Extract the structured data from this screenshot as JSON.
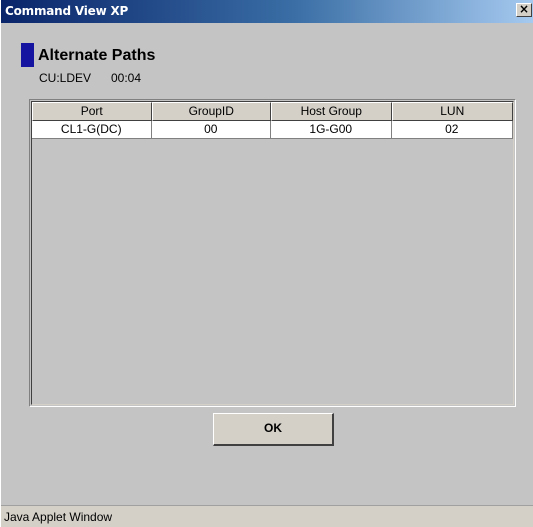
{
  "window": {
    "title": "Command View XP",
    "close_glyph": "×"
  },
  "section": {
    "title": "Alternate Paths",
    "marker_color": "#1414a0",
    "cu_label": "CU:LDEV",
    "cu_value": "00:04"
  },
  "table": {
    "columns": [
      "Port",
      "GroupID",
      "Host Group",
      "LUN"
    ],
    "rows": [
      [
        "CL1-G(DC)",
        "00",
        "1G-G00",
        "02"
      ]
    ]
  },
  "buttons": {
    "ok_label": "OK"
  },
  "status": {
    "text": "Java Applet Window"
  }
}
